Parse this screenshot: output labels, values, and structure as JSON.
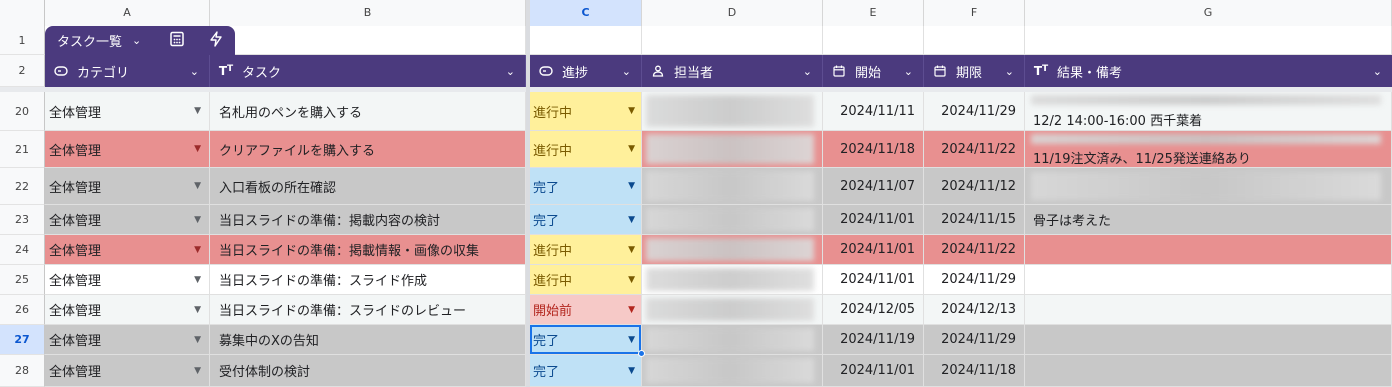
{
  "columns": [
    "A",
    "B",
    "C",
    "D",
    "E",
    "F",
    "G"
  ],
  "selected_column": "C",
  "toolbar": {
    "tab_label": "タスク一覧"
  },
  "headers": {
    "category": "カテゴリ",
    "task": "タスク",
    "progress": "進捗",
    "assignee": "担当者",
    "start": "開始",
    "due": "期限",
    "notes": "結果・備考"
  },
  "header_row_numbers": [
    "1",
    "2"
  ],
  "rows": [
    {
      "num": "20",
      "category": "全体管理",
      "task": "名札用のペンを購入する",
      "status": "進行中",
      "start": "2024/11/11",
      "due": "2024/11/29",
      "notes": "12/2 14:00-16:00 西千葉着"
    },
    {
      "num": "21",
      "category": "全体管理",
      "task": "クリアファイルを購入する",
      "status": "進行中",
      "start": "2024/11/18",
      "due": "2024/11/22",
      "notes": "11/19注文済み、11/25発送連絡あり"
    },
    {
      "num": "22",
      "category": "全体管理",
      "task": "入口看板の所在確認",
      "status": "完了",
      "start": "2024/11/07",
      "due": "2024/11/12",
      "notes": ""
    },
    {
      "num": "23",
      "category": "全体管理",
      "task": "当日スライドの準備：掲載内容の検討",
      "status": "完了",
      "start": "2024/11/01",
      "due": "2024/11/15",
      "notes": "骨子は考えた"
    },
    {
      "num": "24",
      "category": "全体管理",
      "task": "当日スライドの準備：掲載情報・画像の収集",
      "status": "進行中",
      "start": "2024/11/01",
      "due": "2024/11/22",
      "notes": ""
    },
    {
      "num": "25",
      "category": "全体管理",
      "task": "当日スライドの準備：スライド作成",
      "status": "進行中",
      "start": "2024/11/01",
      "due": "2024/11/29",
      "notes": ""
    },
    {
      "num": "26",
      "category": "全体管理",
      "task": "当日スライドの準備：スライドのレビュー",
      "status": "開始前",
      "start": "2024/12/05",
      "due": "2024/12/13",
      "notes": ""
    },
    {
      "num": "27",
      "category": "全体管理",
      "task": "募集中のXの告知",
      "status": "完了",
      "start": "2024/11/19",
      "due": "2024/11/29",
      "notes": ""
    },
    {
      "num": "28",
      "category": "全体管理",
      "task": "受付体制の検討",
      "status": "完了",
      "start": "2024/11/01",
      "due": "2024/11/18",
      "notes": ""
    }
  ],
  "colors": {
    "header_bg": "#4b3a7e",
    "row_red": "#e89090",
    "row_gray": "#c8c8c8",
    "row_light": "#f3f6f6",
    "status_in_progress_bg": "#fff09b",
    "status_in_progress_fg": "#7a5b00",
    "status_done_bg": "#bfe1f6",
    "status_done_fg": "#0b4a8f",
    "status_not_started_bg": "#f6c9c7",
    "status_not_started_fg": "#b3261e"
  }
}
